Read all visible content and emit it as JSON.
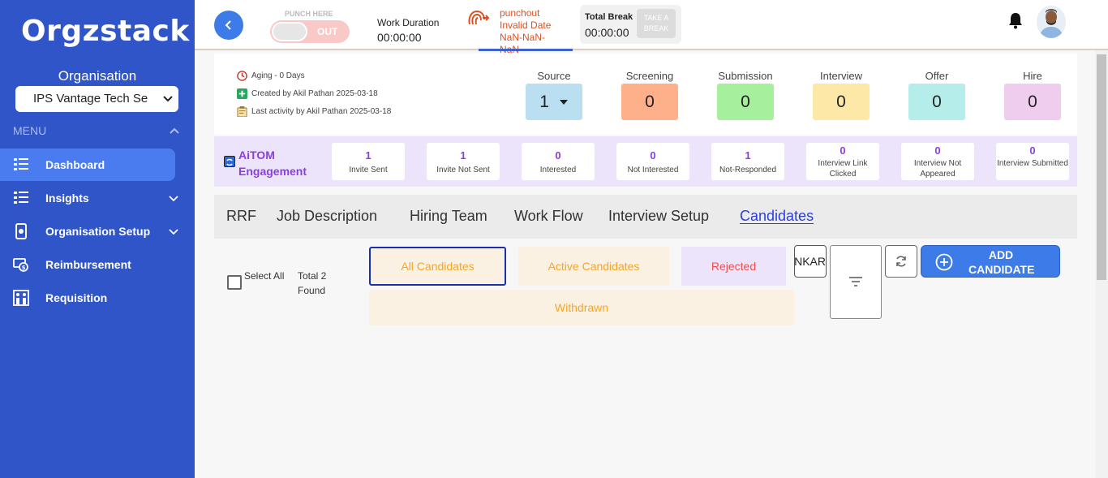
{
  "sidebar": {
    "logo": "Orgzstack",
    "org_label": "Organisation",
    "org_selected": "IPS Vantage Tech Se",
    "menu_label": "MENU",
    "items": [
      {
        "label": "Dashboard",
        "icon": "dashboard-icon",
        "active": true
      },
      {
        "label": "Insights",
        "icon": "insights-icon"
      },
      {
        "label": "Organisation Setup",
        "icon": "organisation-setup-icon"
      },
      {
        "label": "Reimbursement",
        "icon": "reimbursement-icon"
      },
      {
        "label": "Requisition",
        "icon": "requisition-icon"
      }
    ]
  },
  "topbar": {
    "punch_label": "PUNCH HERE",
    "punch_state": "OUT",
    "work_duration_label": "Work Duration",
    "work_duration_value": "00:00:00",
    "punchout_text": "punchout Invalid Date NaN-NaN-NaN",
    "total_break_label": "Total Break",
    "total_break_value": "00:00:00",
    "take_break": "TAKE A BREAK"
  },
  "requisition": {
    "aging": "Aging - 0 Days",
    "created": "Created by Akil Pathan 2025-03-18",
    "last_activity": "Last activity by Akil Pathan 2025-03-18",
    "stages": [
      {
        "label": "Source",
        "value": "1",
        "color": "#b9dff0"
      },
      {
        "label": "Screening",
        "value": "0",
        "color": "#fdb08a"
      },
      {
        "label": "Submission",
        "value": "0",
        "color": "#a6ef9c"
      },
      {
        "label": "Interview",
        "value": "0",
        "color": "#fde8a7"
      },
      {
        "label": "Offer",
        "value": "0",
        "color": "#b4ede9"
      },
      {
        "label": "Hire",
        "value": "0",
        "color": "#efcdef"
      }
    ]
  },
  "aitom": {
    "title": "AiTOM Engagement",
    "cards": [
      {
        "value": "1",
        "label": "Invite Sent"
      },
      {
        "value": "1",
        "label": "Invite Not Sent"
      },
      {
        "value": "0",
        "label": "Interested"
      },
      {
        "value": "0",
        "label": "Not Interested"
      },
      {
        "value": "1",
        "label": "Not-Responded"
      },
      {
        "value": "0",
        "label": "Interview Link Clicked"
      },
      {
        "value": "0",
        "label": "Interview Not Appeared"
      },
      {
        "value": "0",
        "label": "Interview Submitted"
      }
    ]
  },
  "tabs": [
    "RRF",
    "Job Description",
    "Hiring Team",
    "Work Flow",
    "Interview Setup",
    "Candidates"
  ],
  "candidates": {
    "select_all": "Select All",
    "total": "Total 2 Found",
    "filters": {
      "all": "All Candidates",
      "active": "Active Candidates",
      "rejected": "Rejected",
      "withdrawn": "Withdrawn"
    },
    "rank_text": "RANKAR",
    "add_label": "ADD CANDIDATE"
  }
}
